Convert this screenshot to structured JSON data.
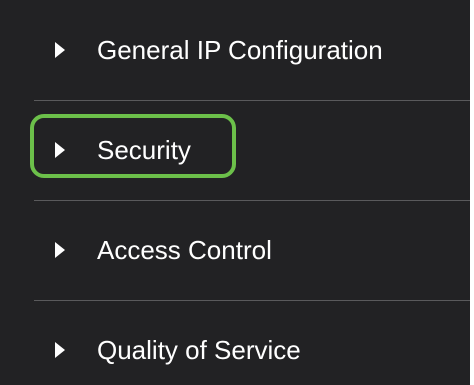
{
  "navigation": {
    "items": [
      {
        "label": "General IP Configuration",
        "icon": "caret-right-icon"
      },
      {
        "label": "Security",
        "icon": "caret-right-icon",
        "highlighted": true
      },
      {
        "label": "Access Control",
        "icon": "caret-right-icon"
      },
      {
        "label": "Quality of Service",
        "icon": "caret-right-icon"
      }
    ]
  },
  "colors": {
    "panel_background": "#222224",
    "text": "#ffffff",
    "divider": "#5a5a5c",
    "highlight_border": "#6cc04a"
  }
}
